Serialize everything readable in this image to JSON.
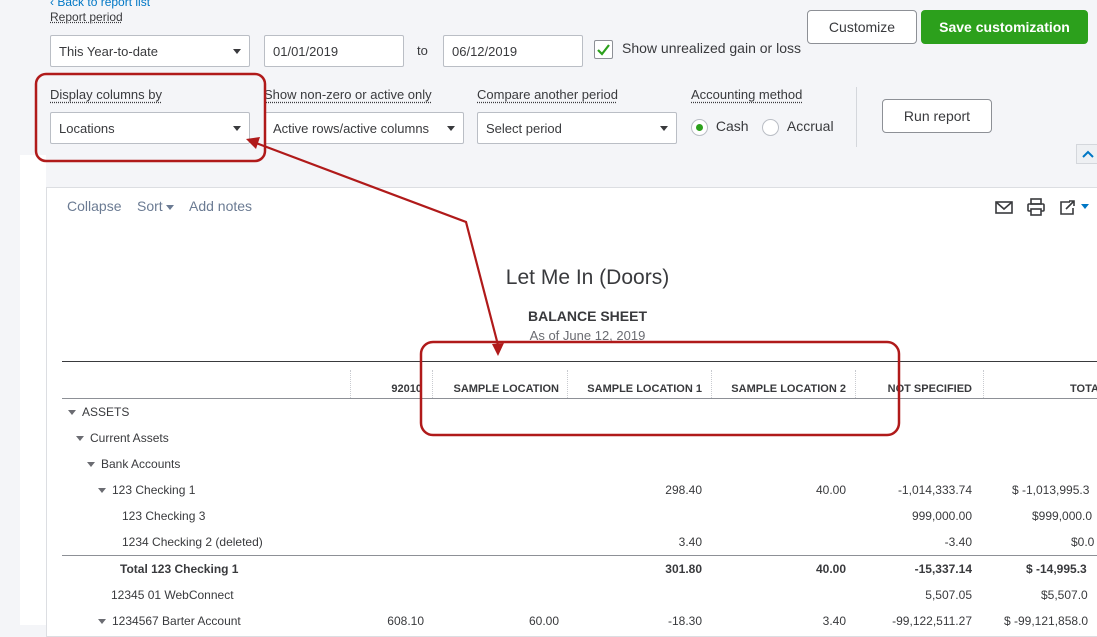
{
  "nav": {
    "back_link": "Back to report list"
  },
  "filters": {
    "report_period_label": "Report period",
    "report_period_value": "This Year-to-date",
    "date_from": "01/01/2019",
    "to_label": "to",
    "date_to": "06/12/2019",
    "unrealized_label": "Show unrealized gain or loss",
    "display_columns_label": "Display columns by",
    "display_columns_value": "Locations",
    "nonzero_label": "Show non-zero or active only",
    "nonzero_value": "Active rows/active columns",
    "compare_label": "Compare another period",
    "compare_value": "Select period",
    "method_label": "Accounting method",
    "cash_label": "Cash",
    "accrual_label": "Accrual"
  },
  "buttons": {
    "customize": "Customize",
    "save": "Save customization",
    "run": "Run report"
  },
  "toolbar": {
    "collapse": "Collapse",
    "sort": "Sort",
    "add_notes": "Add notes"
  },
  "report": {
    "company": "Let Me In (Doors)",
    "title": "BALANCE SHEET",
    "subtitle": "As of June 12, 2019",
    "columns": [
      "92010",
      "SAMPLE LOCATION",
      "SAMPLE LOCATION 1",
      "SAMPLE LOCATION 2",
      "NOT SPECIFIED",
      "TOTAL"
    ],
    "rows": [
      {
        "label": "ASSETS",
        "values": [
          "",
          "",
          "",
          "",
          "",
          ""
        ]
      },
      {
        "label": "Current Assets",
        "values": [
          "",
          "",
          "",
          "",
          "",
          ""
        ]
      },
      {
        "label": "Bank Accounts",
        "values": [
          "",
          "",
          "",
          "",
          "",
          ""
        ]
      },
      {
        "label": "123 Checking 1",
        "values": [
          "",
          "",
          "298.40",
          "40.00",
          "-1,014,333.74",
          "$ -1,013,995.3"
        ]
      },
      {
        "label": "123 Checking 3",
        "values": [
          "",
          "",
          "",
          "",
          "999,000.00",
          "$999,000.0"
        ]
      },
      {
        "label": "1234 Checking 2 (deleted)",
        "values": [
          "",
          "",
          "3.40",
          "",
          "-3.40",
          "$0.0"
        ]
      },
      {
        "label": "Total 123 Checking 1",
        "values": [
          "",
          "",
          "301.80",
          "40.00",
          "-15,337.14",
          "$ -14,995.3"
        ]
      },
      {
        "label": "12345 01 WebConnect",
        "values": [
          "",
          "",
          "",
          "",
          "5,507.05",
          "$5,507.0"
        ]
      },
      {
        "label": "1234567 Barter Account",
        "values": [
          "608.10",
          "60.00",
          "-18.30",
          "3.40",
          "-99,122,511.27",
          "$ -99,121,858.0"
        ]
      }
    ]
  }
}
